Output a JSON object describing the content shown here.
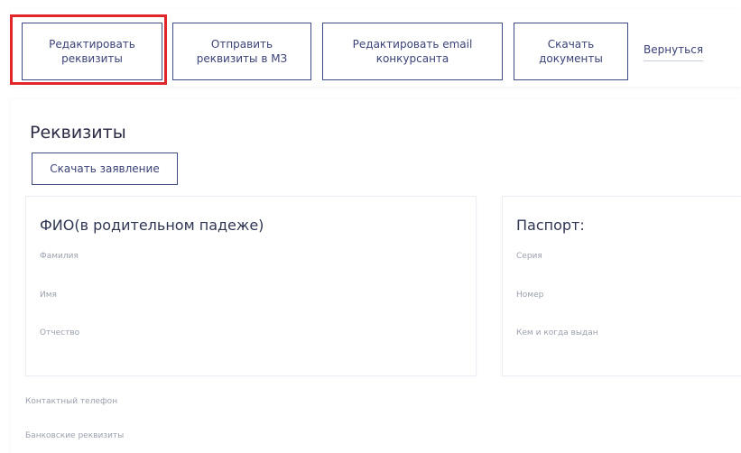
{
  "toolbar": {
    "edit_requisites": [
      "Редактировать",
      "реквизиты"
    ],
    "send_requisites": [
      "Отправить",
      "реквизиты в МЗ"
    ],
    "edit_email": [
      "Редактировать email",
      "конкурсанта"
    ],
    "download_docs": [
      "Скачать",
      "документы"
    ],
    "back_link": "Вернуться"
  },
  "main": {
    "title": "Реквизиты",
    "download_statement": "Скачать заявление",
    "fio_card": {
      "title": "ФИО(в родительном падеже)",
      "fields": [
        "Фамилия",
        "Имя",
        "Отчество"
      ]
    },
    "passport_card": {
      "title": "Паспорт:",
      "fields": [
        "Серия",
        "Номер",
        "Кем и когда выдан"
      ]
    },
    "contact_phone_label": "Контактный телефон",
    "bank_details_label": "Банковские реквизиты"
  },
  "colors": {
    "accent": "#3b4278",
    "highlight": "#e0262b",
    "muted_text": "#9aa0ad"
  }
}
